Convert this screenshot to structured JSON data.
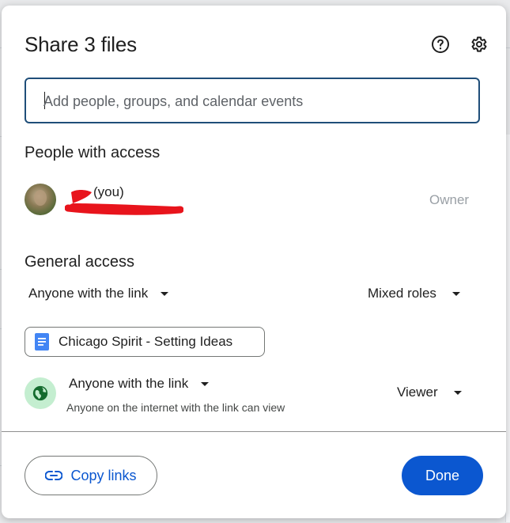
{
  "dialog": {
    "title": "Share 3 files",
    "help_icon": "help-circle-icon",
    "settings_icon": "gear-icon"
  },
  "search": {
    "placeholder": "Add people, groups, and calendar events",
    "value": ""
  },
  "people": {
    "heading": "People with access",
    "entries": [
      {
        "name_suffix": "(you)",
        "role": "Owner",
        "avatar": "profile-photo"
      }
    ]
  },
  "general_access": {
    "heading": "General access",
    "access_selector": "Anyone with the link",
    "roles_selector": "Mixed roles",
    "file_chip": {
      "label": "Chicago Spirit - Setting Ideas",
      "icon": "docs-icon"
    },
    "link_access": {
      "label": "Anyone with the link",
      "description": "Anyone on the internet with the link can view",
      "role": "Viewer",
      "icon": "globe-icon"
    }
  },
  "footer": {
    "copy_links_label": "Copy links",
    "copy_icon": "link-icon",
    "done_label": "Done"
  },
  "colors": {
    "primary": "#0b57d0",
    "search_border": "#1f4e79",
    "globe_bg": "#c4eed0",
    "globe_fg": "#146c2e",
    "redaction": "#e8141c"
  }
}
